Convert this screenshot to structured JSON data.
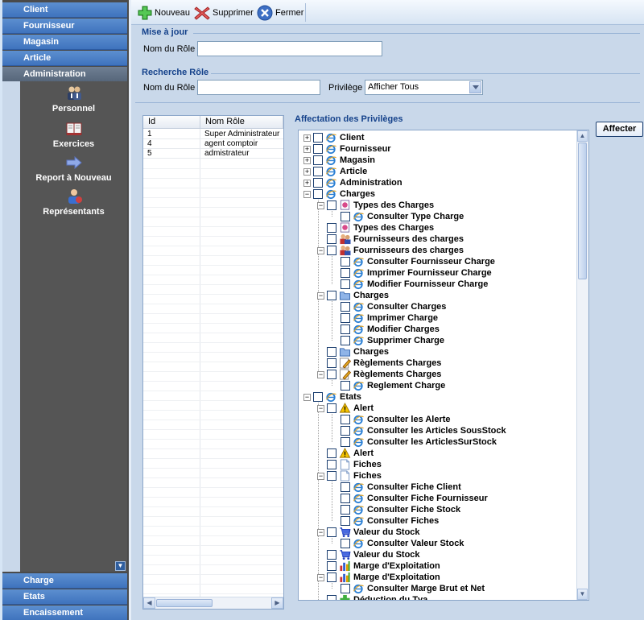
{
  "nav": {
    "headers_top": [
      "Client",
      "Fournisseur",
      "Magasin",
      "Article",
      "Administration"
    ],
    "active_header": "Administration",
    "items": [
      {
        "label": "Personnel",
        "icon": "users-icon"
      },
      {
        "label": "Exercices",
        "icon": "book-icon"
      },
      {
        "label": "Report à Nouveau",
        "icon": "arrow-right-icon"
      },
      {
        "label": "Représentants",
        "icon": "representative-icon"
      }
    ],
    "headers_bottom": [
      "Charge",
      "Etats",
      "Encaissement"
    ]
  },
  "toolbar": {
    "new_label": "Nouveau",
    "delete_label": "Supprimer",
    "close_label": "Fermer"
  },
  "update_section": {
    "title": "Mise à jour",
    "role_label": "Nom du Rôle",
    "role_value": ""
  },
  "search_section": {
    "title": "Recherche Rôle",
    "role_label": "Nom du Rôle",
    "role_value": "",
    "privilege_label": "Privilège",
    "privilege_selected": "Afficher Tous"
  },
  "grid": {
    "columns": [
      "Id",
      "Nom Rôle"
    ],
    "rows": [
      {
        "id": "1",
        "name": "Super Administrateur"
      },
      {
        "id": "4",
        "name": "agent comptoir"
      },
      {
        "id": "5",
        "name": "admistrateur"
      }
    ]
  },
  "privileges": {
    "title": "Affectation des Privilèges",
    "assign_label": "Affecter",
    "tree": [
      {
        "label": "Client",
        "level": 0,
        "expander": "+",
        "icon": "ie"
      },
      {
        "label": "Fournisseur",
        "level": 0,
        "expander": "+",
        "icon": "ie"
      },
      {
        "label": "Magasin",
        "level": 0,
        "expander": "+",
        "icon": "ie"
      },
      {
        "label": "Article",
        "level": 0,
        "expander": "+",
        "icon": "ie"
      },
      {
        "label": "Administration",
        "level": 0,
        "expander": "+",
        "icon": "ie"
      },
      {
        "label": "Charges",
        "level": 0,
        "expander": "-",
        "icon": "ie"
      },
      {
        "label": "Types des Charges",
        "level": 1,
        "expander": "-",
        "icon": "type"
      },
      {
        "label": "Consulter Type Charge",
        "level": 2,
        "expander": "",
        "icon": "ie"
      },
      {
        "label": "Types des Charges",
        "level": 1,
        "expander": "",
        "icon": "type"
      },
      {
        "label": "Fournisseurs des charges",
        "level": 1,
        "expander": "",
        "icon": "supplier"
      },
      {
        "label": "Fournisseurs des charges",
        "level": 1,
        "expander": "-",
        "icon": "supplier"
      },
      {
        "label": "Consulter Fournisseur Charge",
        "level": 2,
        "expander": "",
        "icon": "ie"
      },
      {
        "label": "Imprimer Fournisseur Charge",
        "level": 2,
        "expander": "",
        "icon": "ie"
      },
      {
        "label": "Modifier Fournisseur Charge",
        "level": 2,
        "expander": "",
        "icon": "ie"
      },
      {
        "label": "Charges",
        "level": 1,
        "expander": "-",
        "icon": "folder"
      },
      {
        "label": "Consulter Charges",
        "level": 2,
        "expander": "",
        "icon": "ie"
      },
      {
        "label": "Imprimer Charge",
        "level": 2,
        "expander": "",
        "icon": "ie"
      },
      {
        "label": "Modifier Charges",
        "level": 2,
        "expander": "",
        "icon": "ie"
      },
      {
        "label": "Supprimer Charge",
        "level": 2,
        "expander": "",
        "icon": "ie"
      },
      {
        "label": "Charges",
        "level": 1,
        "expander": "",
        "icon": "folder"
      },
      {
        "label": "Règlements Charges",
        "level": 1,
        "expander": "",
        "icon": "doc-edit"
      },
      {
        "label": "Règlements Charges",
        "level": 1,
        "expander": "-",
        "icon": "doc-edit"
      },
      {
        "label": "Reglement Charge",
        "level": 2,
        "expander": "",
        "icon": "ie"
      },
      {
        "label": "Etats",
        "level": 0,
        "expander": "-",
        "icon": "ie"
      },
      {
        "label": "Alert",
        "level": 1,
        "expander": "-",
        "icon": "warning"
      },
      {
        "label": "Consulter les Alerte",
        "level": 2,
        "expander": "",
        "icon": "ie"
      },
      {
        "label": "Consulter les Articles SousStock",
        "level": 2,
        "expander": "",
        "icon": "ie"
      },
      {
        "label": "Consulter les ArticlesSurStock",
        "level": 2,
        "expander": "",
        "icon": "ie"
      },
      {
        "label": "Alert",
        "level": 1,
        "expander": "",
        "icon": "warning"
      },
      {
        "label": "Fiches",
        "level": 1,
        "expander": "",
        "icon": "page"
      },
      {
        "label": "Fiches",
        "level": 1,
        "expander": "-",
        "icon": "page"
      },
      {
        "label": "Consulter Fiche Client",
        "level": 2,
        "expander": "",
        "icon": "ie"
      },
      {
        "label": "Consulter Fiche Fournisseur",
        "level": 2,
        "expander": "",
        "icon": "ie"
      },
      {
        "label": "Consulter Fiche Stock",
        "level": 2,
        "expander": "",
        "icon": "ie"
      },
      {
        "label": "Consulter Fiches",
        "level": 2,
        "expander": "",
        "icon": "ie"
      },
      {
        "label": "Valeur du Stock",
        "level": 1,
        "expander": "-",
        "icon": "cart"
      },
      {
        "label": "Consulter Valeur Stock",
        "level": 2,
        "expander": "",
        "icon": "ie"
      },
      {
        "label": "Valeur du Stock",
        "level": 1,
        "expander": "",
        "icon": "cart"
      },
      {
        "label": "Marge d'Exploitation",
        "level": 1,
        "expander": "",
        "icon": "chart"
      },
      {
        "label": "Marge d'Exploitation",
        "level": 1,
        "expander": "-",
        "icon": "chart"
      },
      {
        "label": "Consulter Marge Brut et Net",
        "level": 2,
        "expander": "",
        "icon": "ie"
      },
      {
        "label": "Déduction du Tva",
        "level": 1,
        "expander": "",
        "icon": "plus"
      }
    ]
  },
  "colors": {
    "nav_header": "#3f73bd",
    "nav_panel": "#555555",
    "main_bg": "#c9d8ea",
    "section_title": "#15428b"
  }
}
